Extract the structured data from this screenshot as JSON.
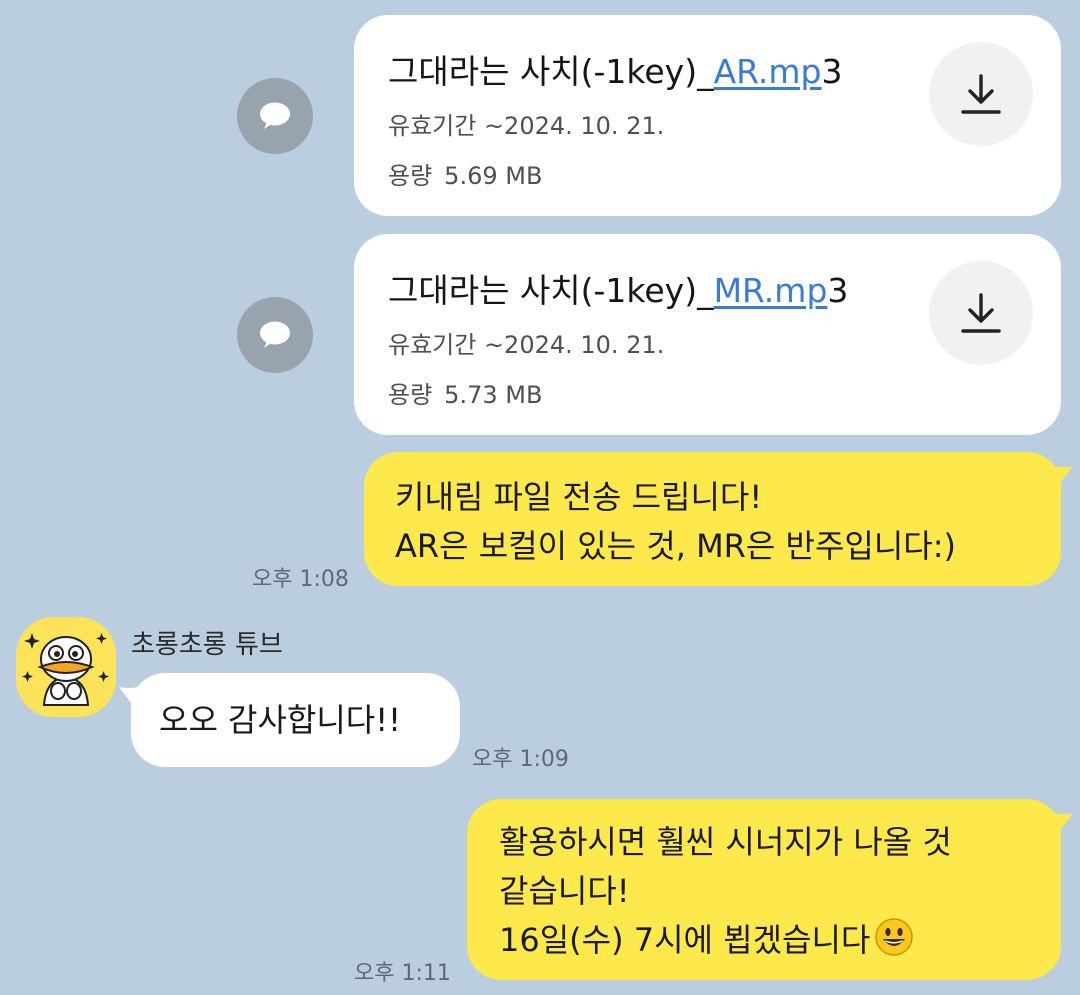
{
  "files": [
    {
      "name_prefix": "그대라는 사치(-1key)_",
      "name_link": "AR.mp",
      "name_suffix": "3",
      "expiry": "유효기간 ~2024. 10. 21.",
      "size_label": "용량",
      "size_value": "5.69 MB",
      "download_icon": "download-icon",
      "comment_icon": "comment-icon"
    },
    {
      "name_prefix": "그대라는 사치(-1key)_",
      "name_link": "MR.mp",
      "name_suffix": "3",
      "expiry": "유효기간 ~2024. 10. 21.",
      "size_label": "용량",
      "size_value": "5.73 MB",
      "download_icon": "download-icon",
      "comment_icon": "comment-icon"
    }
  ],
  "messages": {
    "m1": {
      "lines": [
        "키내림 파일 전송 드립니다!",
        "AR은 보컬이 있는 것, MR은 반주입니다:)"
      ],
      "time": "오후 1:08"
    },
    "m2": {
      "sender": "초롱초롱 튜브",
      "text": "오오 감사합니다!!",
      "time": "오후 1:09"
    },
    "m3": {
      "lines": [
        "활용하시면 훨씬 시너지가 나올 것",
        "같습니다!",
        "16일(수) 7시에 뵙겠습니다"
      ],
      "emoji": "grinning-face-emoji",
      "time": "오후 1:11"
    }
  },
  "colors": {
    "background": "#bacee0",
    "my_bubble": "#fee94d",
    "other_bubble": "#ffffff",
    "link": "#3a7bd5"
  }
}
